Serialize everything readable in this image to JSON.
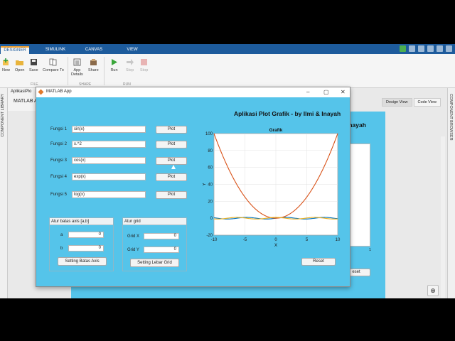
{
  "toolstrip": {
    "tabs": [
      "DESIGNER",
      "SIMULINK",
      "CANVAS",
      "VIEW"
    ],
    "active_tab": "DESIGNER",
    "tools": {
      "new": "New",
      "open": "Open",
      "save": "Save",
      "compare": "Compare To",
      "app_details_1": "App",
      "app_details_2": "Details",
      "share": "Share",
      "run": "Run",
      "step": "Step",
      "stop": "Stop"
    },
    "groups": {
      "file": "FILE",
      "share": "SHARE",
      "run": "RUN"
    }
  },
  "sidebar": {
    "left_label": "COMPONENT LIBRARY",
    "right_label": "COMPONENT BROWSER"
  },
  "designer": {
    "doc_tab": "AplikasiPlo",
    "doc_main": "MATLAB A",
    "view_tabs": [
      "Design View",
      "Code View"
    ],
    "behind_title": "Inayah",
    "behind_tick": "1",
    "behind_button": "eset",
    "zoom_icon": "⊕"
  },
  "app": {
    "window_title": "MATLAB App",
    "controls": {
      "minimize": "–",
      "maximize": "▢",
      "close": "✕"
    },
    "title": "Aplikasi Plot Grafik - by Ilmi & Inayah",
    "functions": [
      {
        "label": "Fungsi 1",
        "value": "sin(x)",
        "button": "Plot"
      },
      {
        "label": "Fungsi 2",
        "value": "x.^2",
        "button": "Plot"
      },
      {
        "label": "Fungsi 3",
        "value": "cos(x)",
        "button": "Plot"
      },
      {
        "label": "Fungsi 4",
        "value": "exp(x)",
        "button": "Plot"
      },
      {
        "label": "Fungsi 5",
        "value": "log(x)",
        "button": "Plot"
      }
    ],
    "axis_panel": {
      "title": "Atur batas axis [a,b]",
      "a_label": "a",
      "a_value": "0",
      "b_label": "b",
      "b_value": "0",
      "button": "Setting Batas Axis"
    },
    "grid_panel": {
      "title": "Atur grid",
      "x_label": "Grid X",
      "x_value": "0",
      "y_label": "Grid Y",
      "y_value": "0",
      "button": "Setting Lebar Grid"
    },
    "reset_button": "Reset"
  },
  "chart_data": {
    "type": "line",
    "title": "Grafik",
    "xlabel": "X",
    "ylabel": "Y",
    "xlim": [
      -10,
      10
    ],
    "ylim": [
      -20,
      100
    ],
    "xticks": [
      -10,
      -5,
      0,
      5,
      10
    ],
    "yticks": [
      -20,
      0,
      20,
      40,
      60,
      80,
      100
    ],
    "grid": true,
    "series": [
      {
        "color": "#0072bd",
        "func": "sin"
      },
      {
        "color": "#d95319",
        "func": "square"
      },
      {
        "color": "#edb120",
        "func": "cos"
      }
    ]
  }
}
